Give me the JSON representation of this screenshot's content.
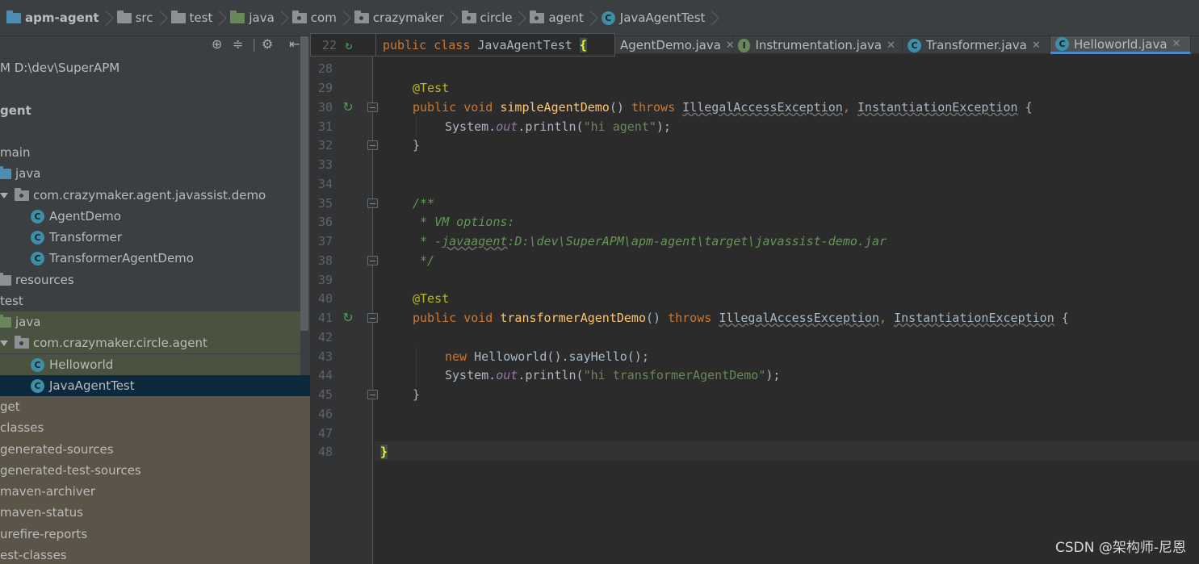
{
  "breadcrumb": {
    "items": [
      "apm-agent",
      "src",
      "test",
      "java",
      "com",
      "crazymaker",
      "circle",
      "agent",
      "JavaAgentTest"
    ]
  },
  "project": {
    "root_label": "M D:\\dev\\SuperAPM",
    "tree": [
      {
        "label": "gent",
        "kind": "module"
      },
      {
        "label": "main",
        "kind": "folder"
      },
      {
        "label": "java",
        "kind": "src-folder"
      },
      {
        "label": "com.crazymaker.agent.javassist.demo",
        "kind": "package"
      },
      {
        "label": "AgentDemo",
        "kind": "class"
      },
      {
        "label": "Transformer",
        "kind": "class"
      },
      {
        "label": "TransformerAgentDemo",
        "kind": "class"
      },
      {
        "label": "resources",
        "kind": "folder"
      },
      {
        "label": "test",
        "kind": "folder"
      },
      {
        "label": "java",
        "kind": "test-folder"
      },
      {
        "label": "com.crazymaker.circle.agent",
        "kind": "package"
      },
      {
        "label": "Helloworld",
        "kind": "class"
      },
      {
        "label": "JavaAgentTest",
        "kind": "class",
        "selected": true
      },
      {
        "label": "get",
        "kind": "folder"
      },
      {
        "label": "classes",
        "kind": "folder"
      },
      {
        "label": "generated-sources",
        "kind": "folder"
      },
      {
        "label": "generated-test-sources",
        "kind": "folder"
      },
      {
        "label": "maven-archiver",
        "kind": "folder"
      },
      {
        "label": "maven-status",
        "kind": "folder"
      },
      {
        "label": "urefire-reports",
        "kind": "folder"
      },
      {
        "label": "est-classes",
        "kind": "folder"
      }
    ]
  },
  "tabs": [
    {
      "label": "AgentDemo.java",
      "icon": "class"
    },
    {
      "label": "Instrumentation.java",
      "icon": "interface"
    },
    {
      "label": "Transformer.java",
      "icon": "class"
    },
    {
      "label": "Helloworld.java",
      "icon": "class",
      "active": true
    }
  ],
  "sticky": {
    "line": "22",
    "code_kw1": "public",
    "code_kw2": "class",
    "code_name": "JavaAgentTest",
    "code_brace": "{"
  },
  "code": {
    "line_numbers": [
      "28",
      "29",
      "30",
      "31",
      "32",
      "33",
      "34",
      "35",
      "36",
      "37",
      "38",
      "39",
      "40",
      "41",
      "42",
      "43",
      "44",
      "45",
      "46",
      "47",
      "48"
    ],
    "ann_test": "@Test",
    "kw_public": "public",
    "kw_void": "void",
    "m1_name": "simpleAgentDemo",
    "paren": "()",
    "kw_throws": "throws",
    "ex1": "IllegalAccessException",
    "ex2": "InstantiationException",
    "open_brace": "{",
    "close_brace": "}",
    "sys": "System.",
    "out": "out",
    "println": ".println(",
    "str1": "\"hi agent\"",
    "end_call": ");",
    "comma": ",",
    "doc_open": "/**",
    "doc_l1": " * VM options:",
    "doc_l2_a": " * -",
    "doc_l2_b": "javaagent",
    "doc_l2_c": ":D:\\dev\\SuperAPM\\apm-agent\\target\\javassist-demo.jar",
    "doc_close": " */",
    "m2_name": "transformerAgentDemo",
    "kw_new": "new",
    "new_expr": " Helloworld().sayHello();",
    "str2": "\"hi transformerAgentDemo\""
  },
  "watermark": "CSDN @架构师-尼恩"
}
